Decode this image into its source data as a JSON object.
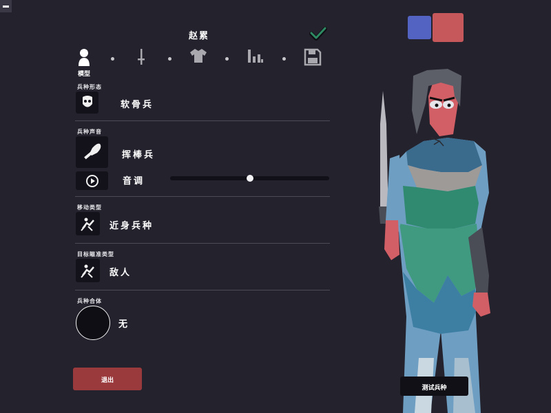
{
  "header": {
    "unit_name": "赵累"
  },
  "tabs": [
    {
      "id": "model",
      "label": "模型",
      "icon": "person-icon",
      "active": true
    },
    {
      "id": "weapon",
      "label": "",
      "icon": "sword-icon"
    },
    {
      "id": "clothing",
      "label": "",
      "icon": "shirt-icon"
    },
    {
      "id": "stats",
      "label": "",
      "icon": "bar-chart-icon"
    },
    {
      "id": "save",
      "label": "",
      "icon": "floppy-disk-icon"
    }
  ],
  "sections": {
    "unit_form": {
      "label": "兵种形态",
      "value": "软骨兵"
    },
    "unit_voice": {
      "label": "兵种声音",
      "value": "挥棒兵",
      "pitch_label": "音调",
      "pitch_level": 0.5
    },
    "movement": {
      "label": "移动类型",
      "value": "近身兵种"
    },
    "targeting": {
      "label": "目标瞄准类型",
      "value": "敌人"
    },
    "combine": {
      "label": "兵种合体",
      "value": "无"
    }
  },
  "buttons": {
    "exit": "退出",
    "test_unit": "测试兵种"
  },
  "colors": {
    "team_blue": "#5263c2",
    "team_red": "#c6575b",
    "exit": "#9b3a3d",
    "background": "#24222d"
  }
}
